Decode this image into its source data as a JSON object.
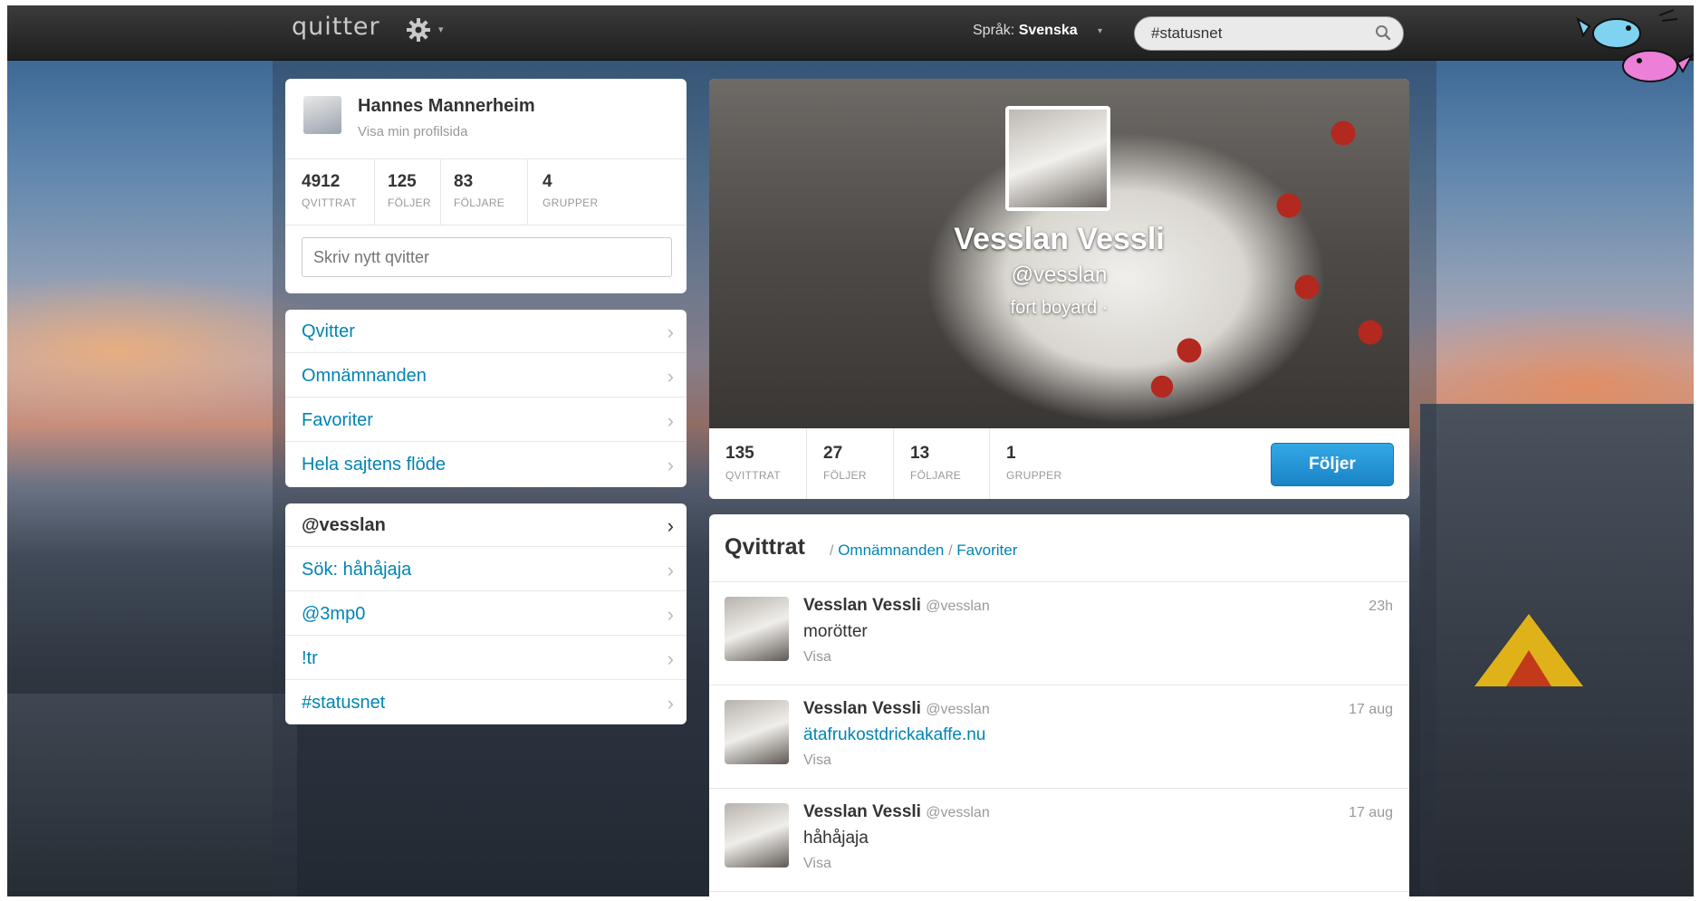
{
  "topbar": {
    "logo": "quitter",
    "logo_caret": "▾",
    "language_label": "Språk:",
    "language_value": "Svenska",
    "language_caret": "▾",
    "search_value": "#statusnet"
  },
  "profile_card": {
    "name": "Hannes Mannerheim",
    "link": "Visa min profilsida",
    "stats": [
      {
        "num": "4912",
        "label": "QVITTRAT"
      },
      {
        "num": "125",
        "label": "FÖLJER"
      },
      {
        "num": "83",
        "label": "FÖLJARE"
      },
      {
        "num": "4",
        "label": "GRUPPER"
      }
    ],
    "compose_placeholder": "Skriv nytt qvitter"
  },
  "nav": {
    "main": [
      {
        "label": "Qvitter"
      },
      {
        "label": "Omnämnanden"
      },
      {
        "label": "Favoriter"
      },
      {
        "label": "Hela sajtens flöde"
      }
    ],
    "saved": [
      {
        "label": "@vesslan",
        "active": true
      },
      {
        "label": "Sök: håhåjaja"
      },
      {
        "label": "@3mp0"
      },
      {
        "label": "!tr"
      },
      {
        "label": "#statusnet"
      }
    ],
    "chevron": "›"
  },
  "profile_header": {
    "name": "Vesslan Vessli",
    "handle": "@vesslan",
    "location": "fort boyard ·",
    "stats": [
      {
        "num": "135",
        "label": "QVITTRAT"
      },
      {
        "num": "27",
        "label": "FÖLJER"
      },
      {
        "num": "13",
        "label": "FÖLJARE"
      },
      {
        "num": "1",
        "label": "GRUPPER"
      }
    ],
    "follow_button": "Följer"
  },
  "stream": {
    "title": "Qvittrat",
    "sep": "/",
    "tab_mentions": "Omnämnanden",
    "tab_favorites": "Favoriter",
    "notices": [
      {
        "name": "Vesslan Vessli",
        "handle": "@vesslan",
        "time": "23h",
        "text": "morötter",
        "is_link": false,
        "action": "Visa"
      },
      {
        "name": "Vesslan Vessli",
        "handle": "@vesslan",
        "time": "17 aug",
        "text": "ätafrukostdrickakaffe.nu",
        "is_link": true,
        "action": "Visa"
      },
      {
        "name": "Vesslan Vessli",
        "handle": "@vesslan",
        "time": "17 aug",
        "text": "håhåjaja",
        "is_link": false,
        "action": "Visa"
      }
    ]
  },
  "colors": {
    "link": "#0084b4",
    "follow_button": "#1a84c7",
    "topbar": "#2a2a2a"
  }
}
